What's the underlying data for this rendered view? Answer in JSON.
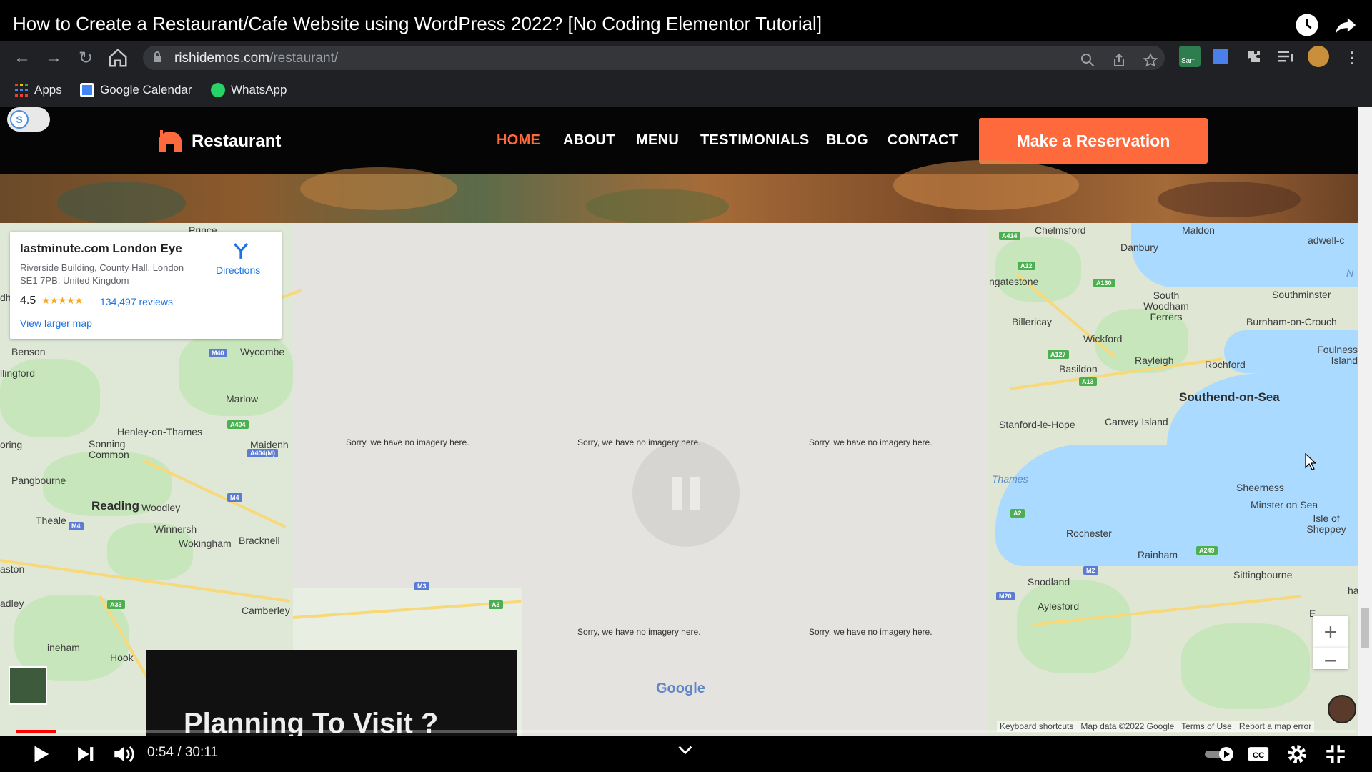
{
  "video": {
    "title": "How to Create a Restaurant/Cafe Website using WordPress 2022? [No Coding Elementor Tutorial]",
    "current_time": "0:54",
    "duration": "30:11",
    "time_display": "0:54 / 30:11",
    "progress_fraction": 0.03
  },
  "browser": {
    "url_host": "rishidemos.com",
    "url_path": "/restaurant/",
    "extension_label": "Sam",
    "bookmarks": [
      {
        "label": "Apps",
        "icon": "apps-grid-icon"
      },
      {
        "label": "Google Calendar",
        "icon": "google-calendar-icon"
      },
      {
        "label": "WhatsApp",
        "icon": "whatsapp-icon"
      }
    ]
  },
  "site": {
    "toggle_letter": "S",
    "logo_text": "Restaurant",
    "nav": [
      {
        "label": "HOME",
        "active": true
      },
      {
        "label": "ABOUT",
        "active": false
      },
      {
        "label": "MENU",
        "active": false
      },
      {
        "label": "TESTIMONIALS",
        "active": false
      },
      {
        "label": "BLOG",
        "active": false
      },
      {
        "label": "CONTACT",
        "active": false
      }
    ],
    "cta_label": "Make a Reservation",
    "accent_color": "#ff6a3d",
    "planning_heading": "Planning To Visit ?"
  },
  "map": {
    "card": {
      "name": "lastminute.com London Eye",
      "address": "Riverside Building, County Hall, London SE1 7PB, United Kingdom",
      "rating": "4.5",
      "reviews": "134,497 reviews",
      "larger_map": "View larger map",
      "directions": "Directions"
    },
    "no_imagery": "Sorry, we have no imagery here.",
    "google_logo": "Google",
    "footer": {
      "shortcuts": "Keyboard shortcuts",
      "data": "Map data ©2022 Google",
      "terms": "Terms of Use",
      "report": "Report a map error"
    },
    "zoom_in": "+",
    "zoom_out": "−",
    "places_left": [
      "Prince",
      "Benson",
      "Wycombe",
      "llingford",
      "Marlow",
      "Henley-on-Thames",
      "oring",
      "Sonning Common",
      "Maidenh",
      "Pangbourne",
      "Reading",
      "Woodley",
      "Theale",
      "Winnersh",
      "Wokingham",
      "Bracknell",
      "aston",
      "adley",
      "Camberley",
      "ineham",
      "Hook",
      "dh"
    ],
    "places_right": [
      "Chelmsford",
      "Maldon",
      "Danbury",
      "adwell-c",
      "ngatestone",
      "N",
      "South Woodham Ferrers",
      "Southminster",
      "Billericay",
      "Burnham-on-Crouch",
      "Wickford",
      "Foulness Island",
      "Rayleigh",
      "Rochford",
      "Basildon",
      "Southend-on-Sea",
      "Stanford-le-Hope",
      "Canvey Island",
      "Thames",
      "Sheerness",
      "Minster on Sea",
      "Isle of Sheppey",
      "Rochester",
      "Rainham",
      "Sittingbourne",
      "Snodland",
      "Aylesford",
      "E",
      "ha"
    ],
    "road_shields": [
      "A414",
      "A12",
      "A130",
      "A127",
      "A13",
      "A2",
      "M2",
      "A249",
      "M20",
      "M40",
      "A404",
      "A404(M)",
      "M4",
      "A33",
      "M3",
      "A3"
    ]
  }
}
